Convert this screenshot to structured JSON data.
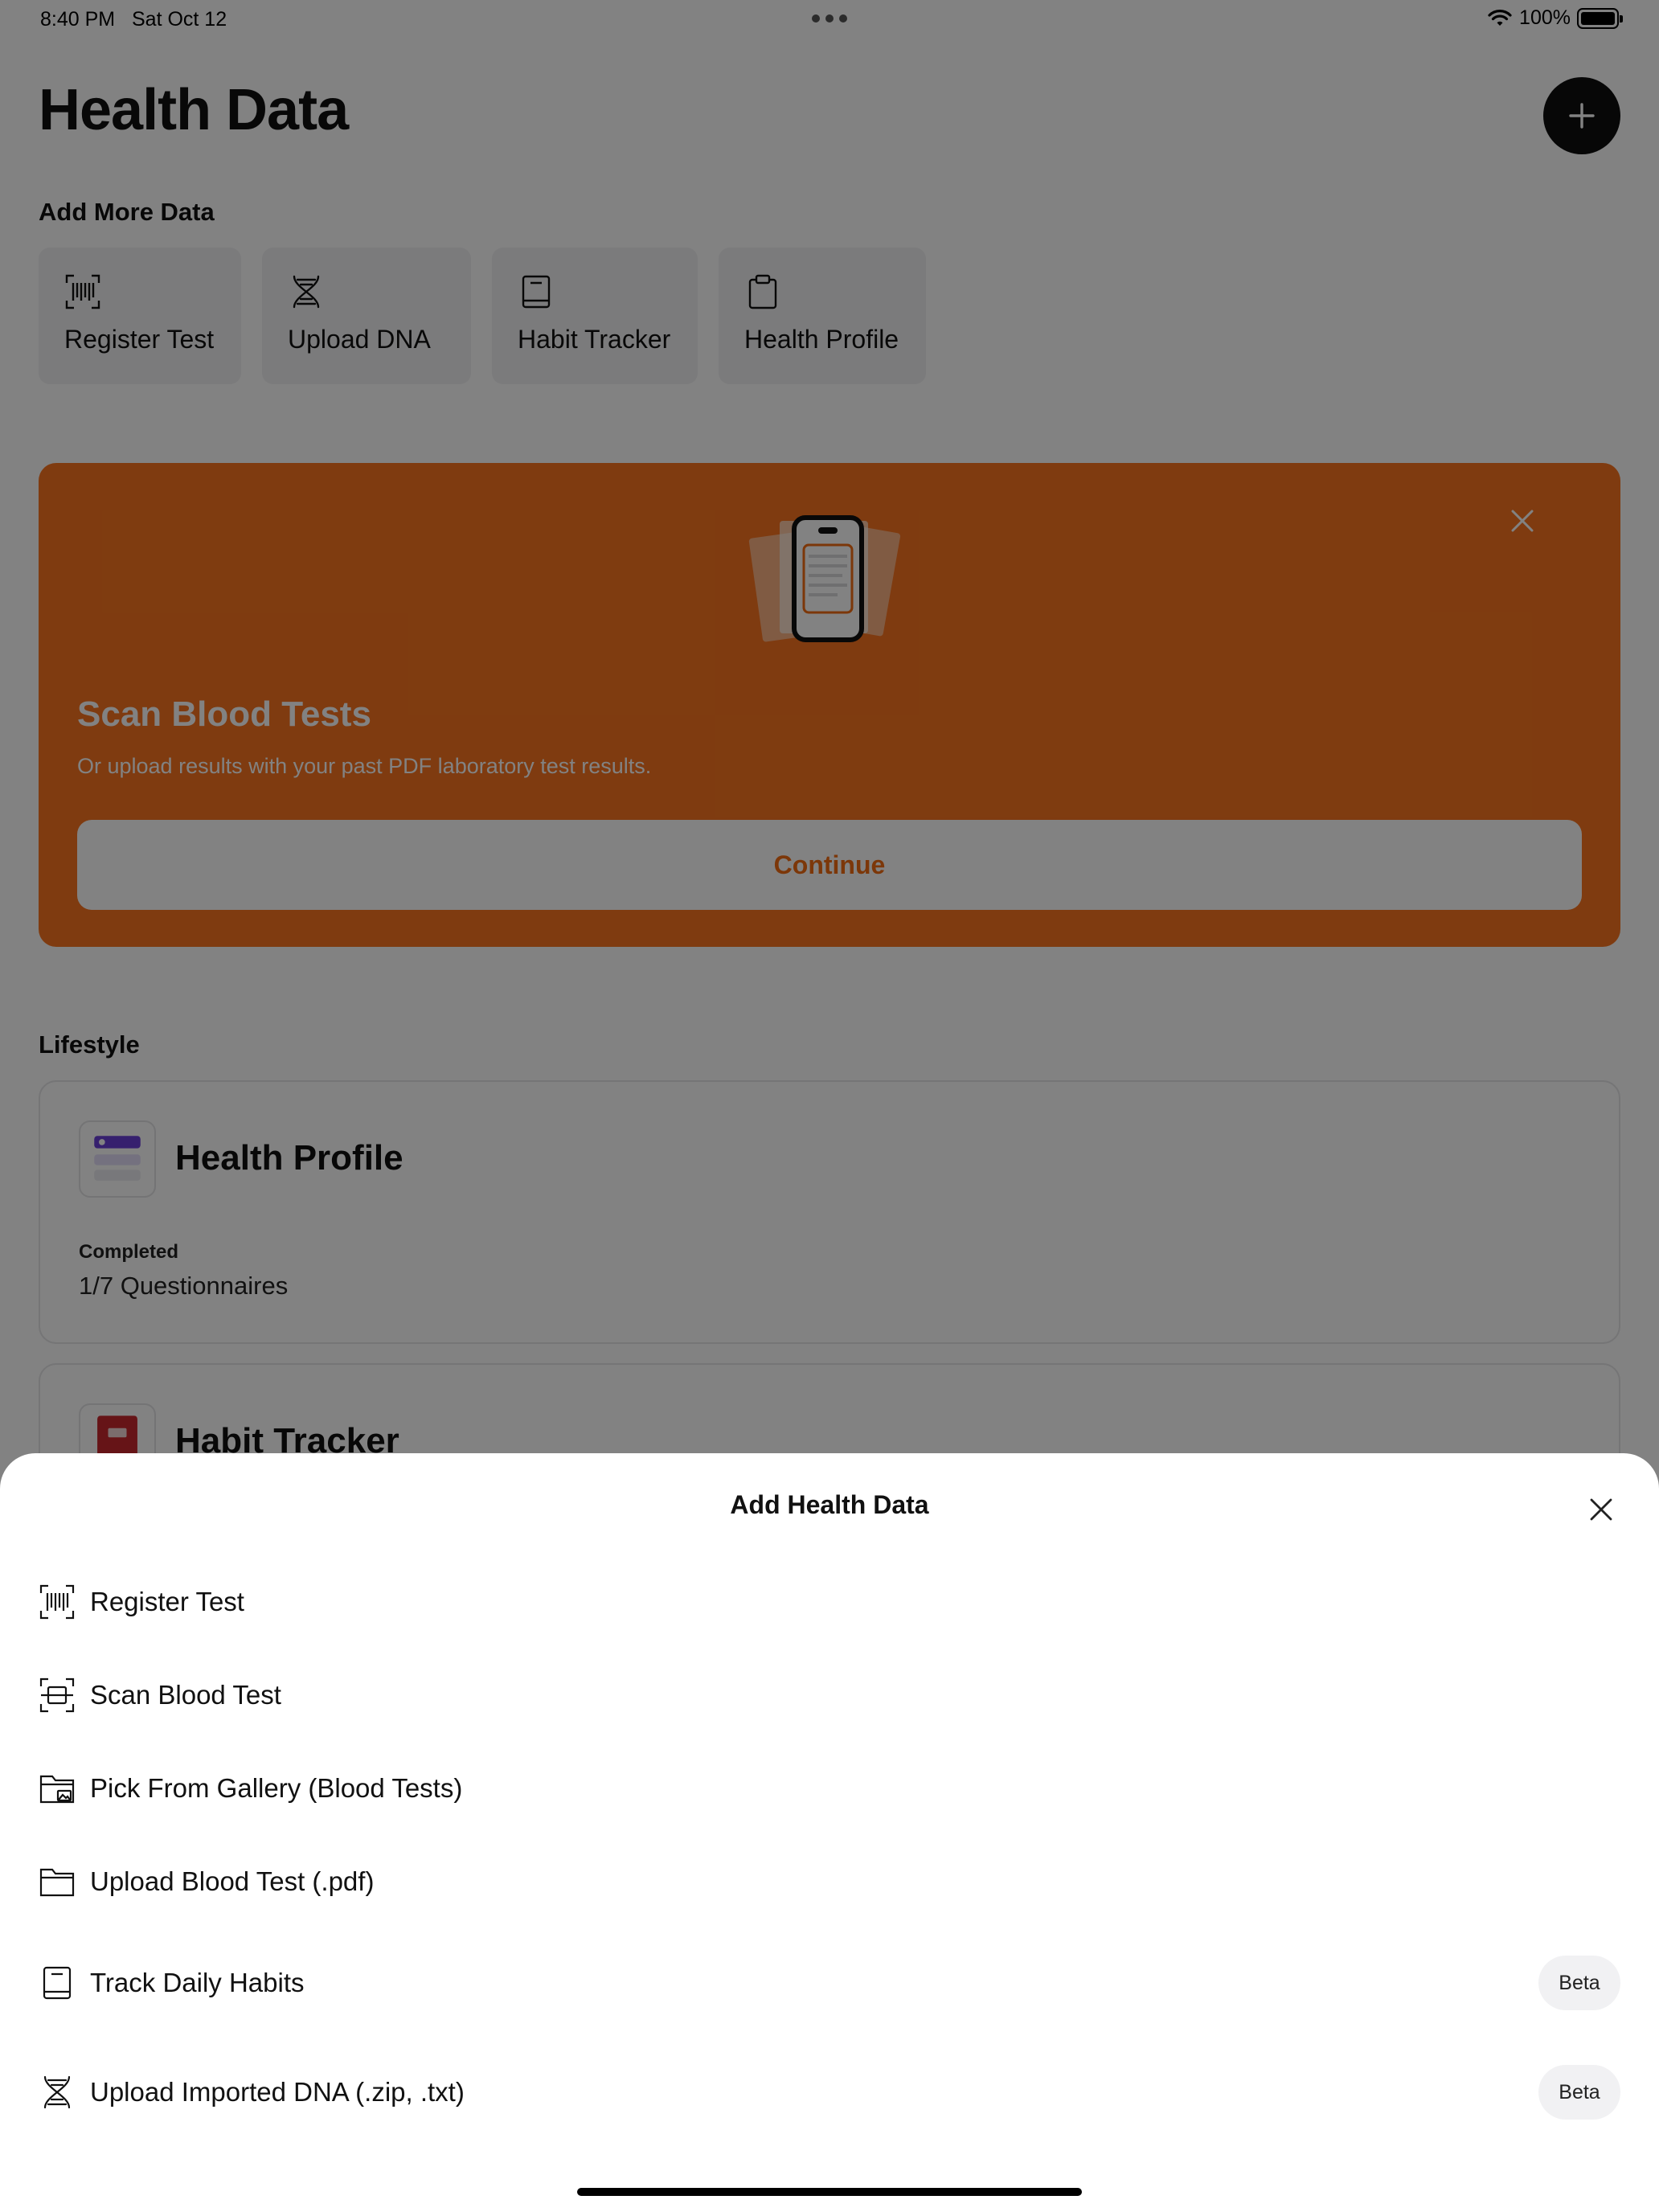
{
  "status_bar": {
    "time": "8:40 PM",
    "date": "Sat Oct 12",
    "battery": "100%"
  },
  "page": {
    "title": "Health Data"
  },
  "add_more": {
    "heading": "Add More Data",
    "items": [
      {
        "label": "Register Test",
        "icon": "barcode-scan-icon"
      },
      {
        "label": "Upload DNA",
        "icon": "dna-icon"
      },
      {
        "label": "Habit Tracker",
        "icon": "book-icon"
      },
      {
        "label": "Health Profile",
        "icon": "clipboard-icon"
      }
    ]
  },
  "promo": {
    "title": "Scan Blood Tests",
    "subtitle": "Or upload results with your past PDF laboratory test results.",
    "button": "Continue",
    "background": "#fa7520",
    "accent": "#f36d12"
  },
  "lifestyle": {
    "heading": "Lifestyle",
    "health_profile": {
      "title": "Health Profile",
      "meta_label": "Completed",
      "meta_value": "1/7 Questionnaires"
    },
    "habit_tracker": {
      "title": "Habit Tracker"
    }
  },
  "sheet": {
    "title": "Add Health Data",
    "options": [
      {
        "label": "Register Test",
        "icon": "barcode-scan-icon"
      },
      {
        "label": "Scan Blood Test",
        "icon": "scan-document-icon"
      },
      {
        "label": "Pick From Gallery (Blood Tests)",
        "icon": "folder-image-icon"
      },
      {
        "label": "Upload Blood Test (.pdf)",
        "icon": "folder-icon"
      },
      {
        "label": "Track Daily Habits",
        "icon": "book-icon",
        "badge": "Beta"
      },
      {
        "label": "Upload Imported DNA (.zip, .txt)",
        "icon": "dna-icon",
        "badge": "Beta"
      }
    ]
  }
}
